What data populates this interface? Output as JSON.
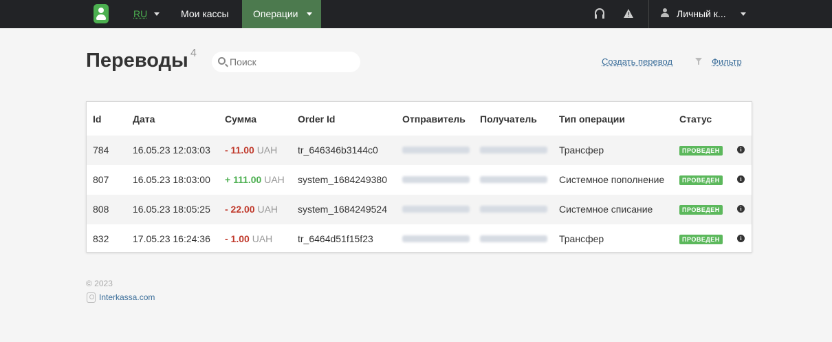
{
  "nav": {
    "lang": "RU",
    "cashboxes": "Мои кассы",
    "operations": "Операции",
    "user": "Личный к..."
  },
  "header": {
    "title": "Переводы",
    "count": "4",
    "search_placeholder": "Поиск",
    "create_label": "Создать перевод",
    "filter_label": "Фильтр"
  },
  "table": {
    "columns": [
      "Id",
      "Дата",
      "Сумма",
      "Order Id",
      "Отправитель",
      "Получатель",
      "Тип операции",
      "Статус"
    ],
    "rows": [
      {
        "id": "784",
        "date": "16.05.23 12:03:03",
        "amount": "- 11.00",
        "currency": "UAH",
        "order_id": "tr_646346b3144c0",
        "type": "Трансфер",
        "status": "ПРОВЕДЕН"
      },
      {
        "id": "807",
        "date": "16.05.23 18:03:00",
        "amount": "+ 111.00",
        "currency": "UAH",
        "order_id": "system_1684249380",
        "type": "Системное пополнение",
        "status": "ПРОВЕДЕН"
      },
      {
        "id": "808",
        "date": "16.05.23 18:05:25",
        "amount": "- 22.00",
        "currency": "UAH",
        "order_id": "system_1684249524",
        "type": "Системное списание",
        "status": "ПРОВЕДЕН"
      },
      {
        "id": "832",
        "date": "17.05.23 16:24:36",
        "amount": "- 1.00",
        "currency": "UAH",
        "order_id": "tr_6464d51f15f23",
        "type": "Трансфер",
        "status": "ПРОВЕДЕН"
      }
    ]
  },
  "footer": {
    "copyright": "© 2023",
    "link": "Interkassa.com"
  },
  "colors": {
    "accent": "#4caf50",
    "navbar": "#222326",
    "negative": "#c0392b",
    "link": "#3a6d99"
  }
}
